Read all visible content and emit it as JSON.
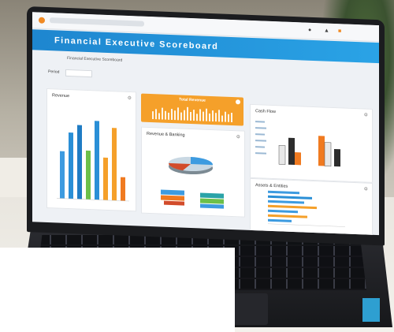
{
  "dashboard": {
    "title": "Financial Executive Scoreboard",
    "breadcrumb": "Financial Executive Scoreboard",
    "period_label": "Period",
    "cards": {
      "revenue": "Revenue",
      "total_revenue": "Total Revenue",
      "revenue_banking": "Revenue & Banking",
      "cash_flow": "Cash Flow",
      "assets_entities": "Assets & Entities"
    }
  },
  "colors": {
    "title_band": "#1e86cf",
    "accent_orange": "#f5a02a",
    "bar_blue": "#2a8fd6",
    "bar_green": "#6cc04a"
  }
}
